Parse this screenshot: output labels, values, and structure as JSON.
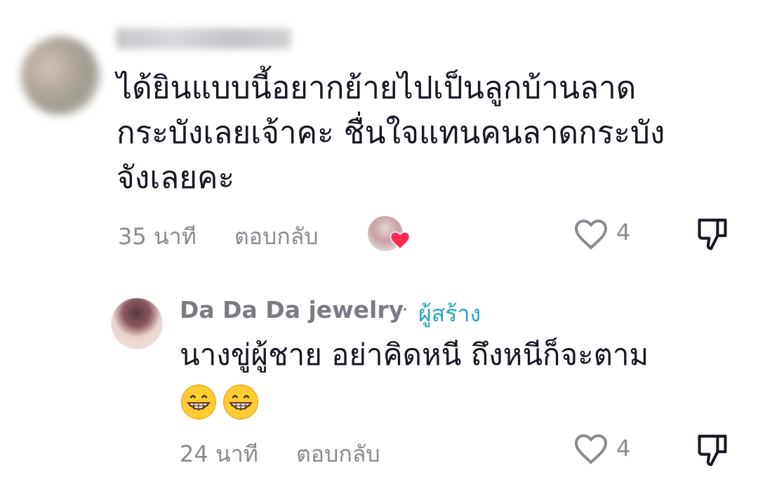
{
  "comments": [
    {
      "author": "",
      "text_lines": [
        "ได้ยินแบบนี้อยากย้ายไปเป็นลูกบ้านลาด",
        "กระบังเลยเจ้าคะ ชื่นใจแทนคนลาดกระบัง",
        "จังเลยคะ"
      ],
      "time": "35 นาที",
      "reply_label": "ตอบกลับ",
      "like_count": "4",
      "liked_by_creator": true
    },
    {
      "author": "Da Da Da jewelry",
      "separator": "·",
      "author_tag": "ผู้สร้าง",
      "text_lines": [
        "นางขู่ผู้ชาย อย่าคิดหนี ถึงหนีก็จะตาม"
      ],
      "emojis": [
        "grinning-face-icon",
        "grinning-face-icon"
      ],
      "time": "24 นาที",
      "reply_label": "ตอบกลับ",
      "like_count": "4"
    }
  ],
  "colors": {
    "text": "#161823",
    "meta": "#8a8b91",
    "creator_tag": "#24a7c2",
    "heart": "#fe2c55"
  }
}
